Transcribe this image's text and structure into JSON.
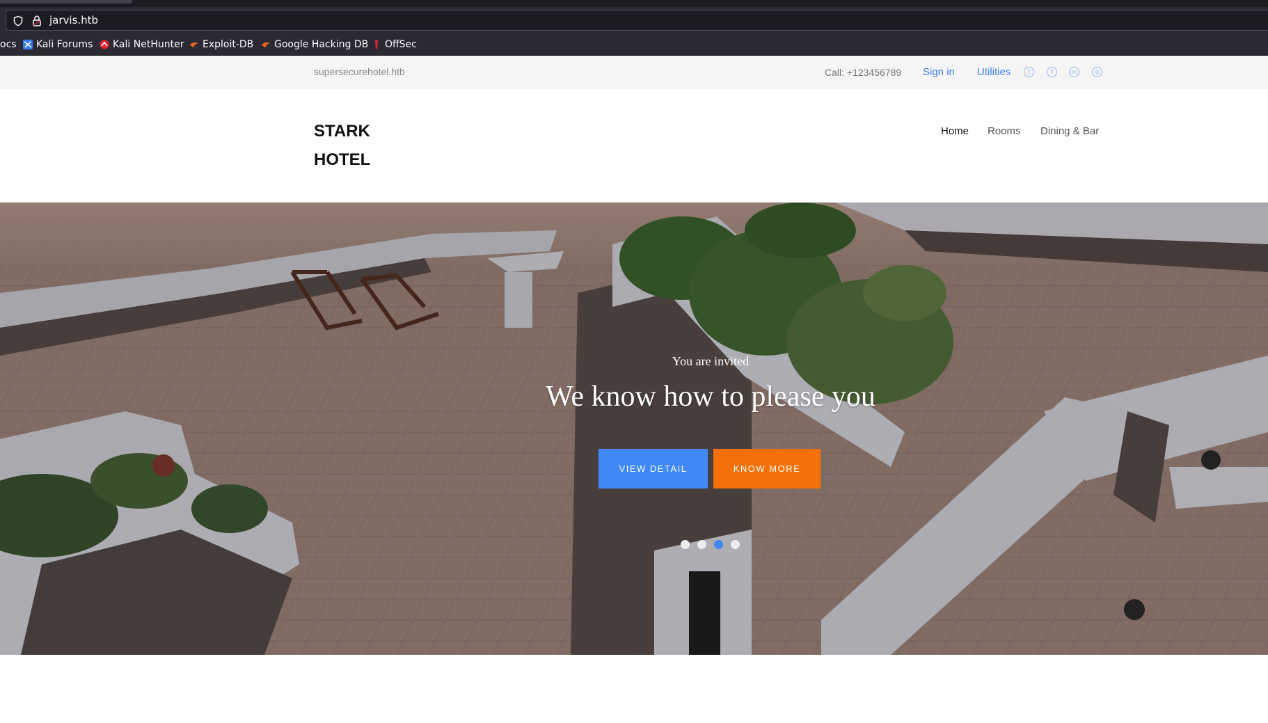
{
  "browser": {
    "url": "jarvis.htb",
    "bookmarks": [
      {
        "label": "ocs",
        "icon": "truncated"
      },
      {
        "label": "Kali Forums",
        "icon": "kali-forums-icon"
      },
      {
        "label": "Kali NetHunter",
        "icon": "kali-nethunter-icon"
      },
      {
        "label": "Exploit-DB",
        "icon": "exploit-db-icon"
      },
      {
        "label": "Google Hacking DB",
        "icon": "ghdb-icon"
      },
      {
        "label": "OffSec",
        "icon": "offsec-icon"
      }
    ]
  },
  "topbar": {
    "domain": "supersecurehotel.htb",
    "call": "Call: +123456789",
    "sign_in": "Sign in",
    "utilities": "Utilities",
    "social_icons": [
      "twitter-icon",
      "facebook-icon",
      "linkedin-icon",
      "instagram-icon"
    ]
  },
  "header": {
    "brand_line1": "STARK",
    "brand_line2": "HOTEL",
    "nav": [
      {
        "label": "Home",
        "active": true
      },
      {
        "label": "Rooms",
        "active": false
      },
      {
        "label": "Dining & Bar",
        "active": false
      }
    ]
  },
  "hero": {
    "kicker": "You are invited",
    "title": "We know how to please you",
    "btn_view": "VIEW DETAIL",
    "btn_know": "KNOW MORE",
    "slides_total": 4,
    "slide_active": 3
  },
  "colors": {
    "accent_blue": "#3f88f5",
    "accent_orange": "#f57108",
    "link_blue": "#3d7eea"
  }
}
